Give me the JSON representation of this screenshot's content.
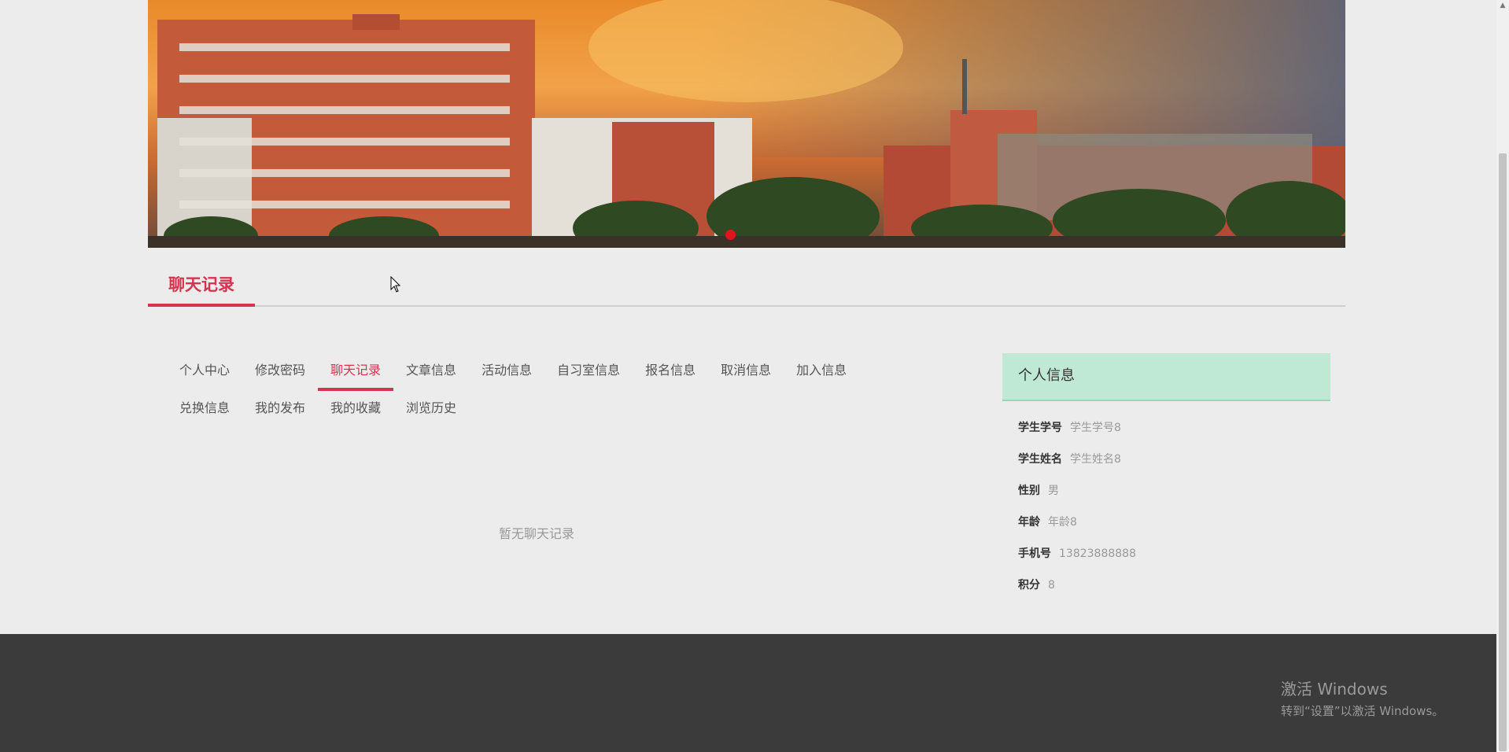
{
  "page_title": "聊天记录",
  "nav": {
    "row1": [
      "个人中心",
      "修改密码",
      "聊天记录",
      "文章信息",
      "活动信息",
      "自习室信息",
      "报名信息",
      "取消信息",
      "加入信息"
    ],
    "row2": [
      "兑换信息",
      "我的发布",
      "我的收藏",
      "浏览历史"
    ],
    "active": "聊天记录"
  },
  "empty_message": "暂无聊天记录",
  "profile": {
    "title": "个人信息",
    "fields": [
      {
        "label": "学生学号",
        "value": "学生学号8"
      },
      {
        "label": "学生姓名",
        "value": "学生姓名8"
      },
      {
        "label": "性别",
        "value": "男"
      },
      {
        "label": "年龄",
        "value": "年龄8"
      },
      {
        "label": "手机号",
        "value": "13823888888"
      },
      {
        "label": "积分",
        "value": "8"
      }
    ]
  },
  "watermark": {
    "line1": "激活 Windows",
    "line2": "转到“设置”以激活 Windows。"
  },
  "colors": {
    "accent": "#d6344e",
    "card_header": "#bfe8d5",
    "footer": "#3b3b3b"
  }
}
